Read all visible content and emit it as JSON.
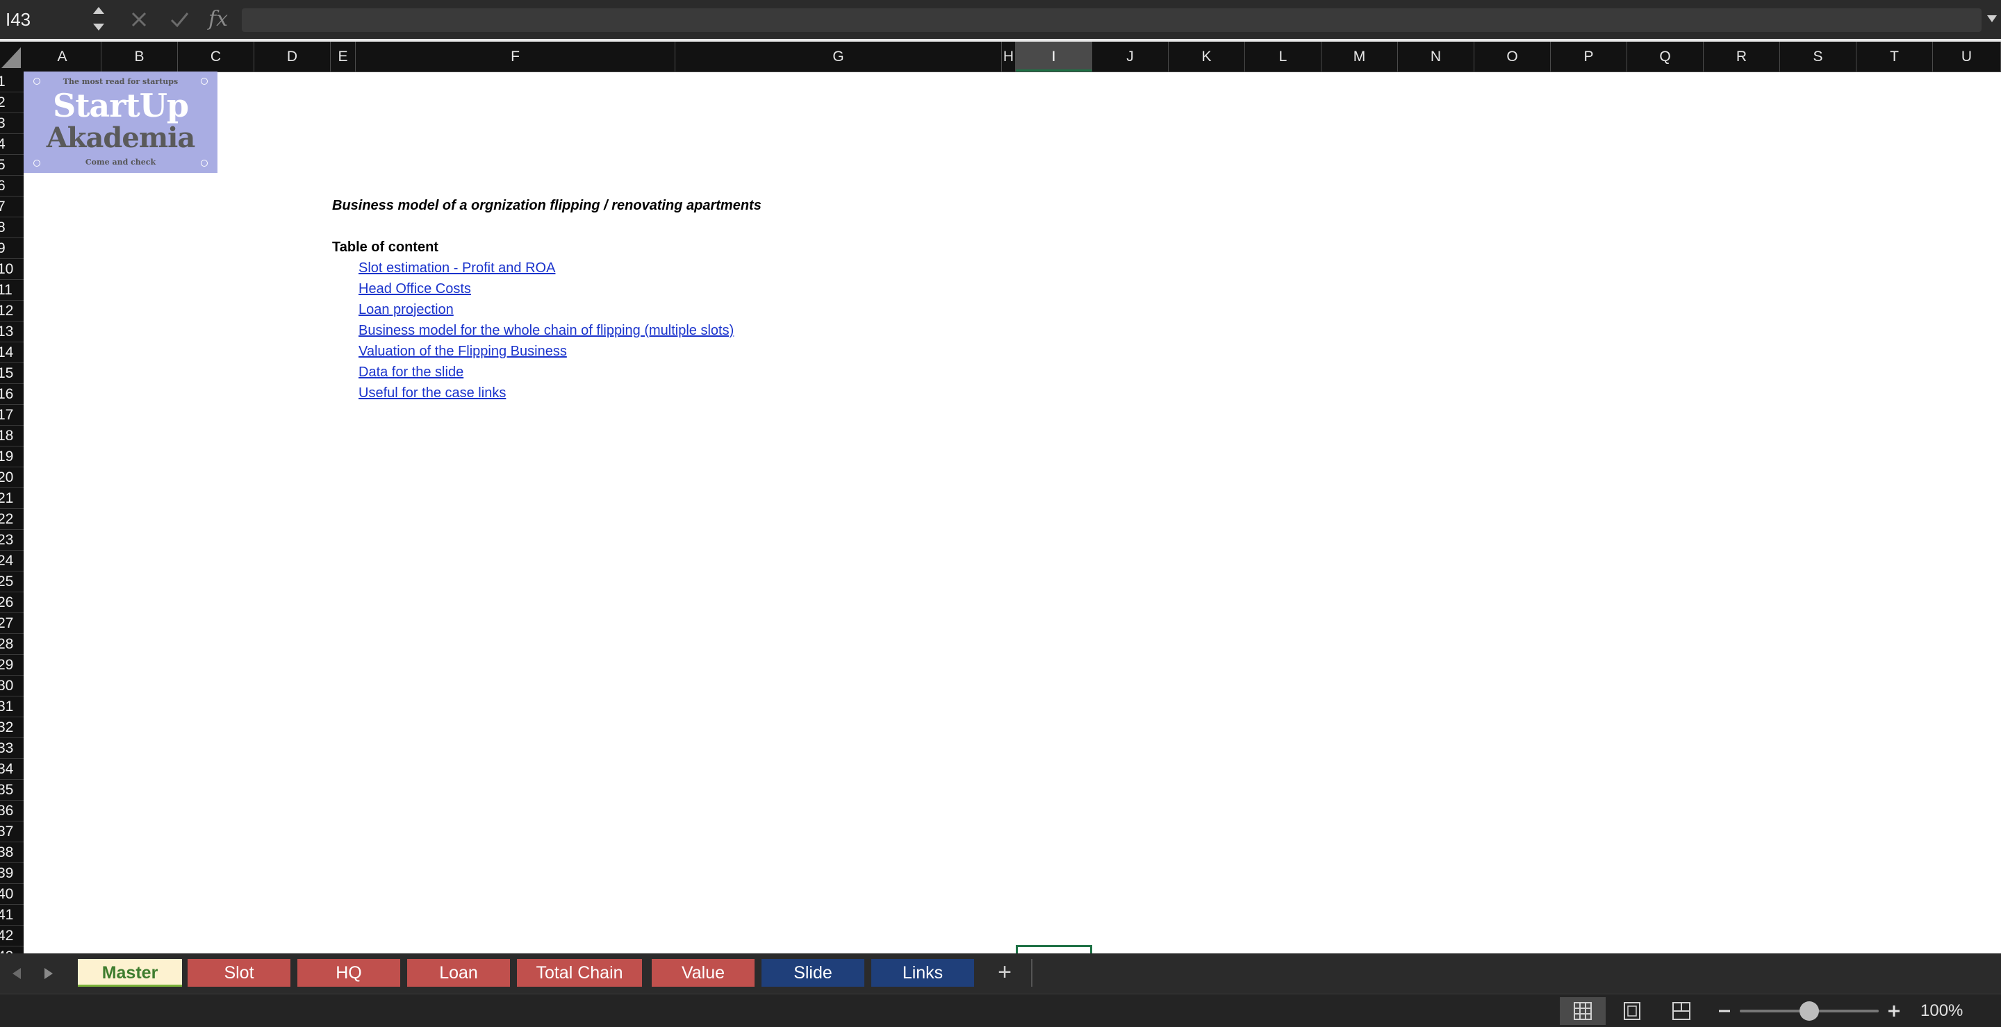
{
  "formula_bar": {
    "name_box": "I43",
    "fx_label": "fx",
    "formula_value": ""
  },
  "columns": [
    {
      "label": "A"
    },
    {
      "label": "B"
    },
    {
      "label": "C"
    },
    {
      "label": "D"
    },
    {
      "label": "E"
    },
    {
      "label": "F"
    },
    {
      "label": "G"
    },
    {
      "label": "H"
    },
    {
      "label": "I",
      "selected": true
    },
    {
      "label": "J"
    },
    {
      "label": "K"
    },
    {
      "label": "L"
    },
    {
      "label": "M"
    },
    {
      "label": "N"
    },
    {
      "label": "O"
    },
    {
      "label": "P"
    },
    {
      "label": "Q"
    },
    {
      "label": "R"
    },
    {
      "label": "S"
    },
    {
      "label": "T"
    },
    {
      "label": "U"
    }
  ],
  "rows": [
    "1",
    "2",
    "3",
    "4",
    "5",
    "6",
    "7",
    "8",
    "9",
    "10",
    "11",
    "12",
    "13",
    "14",
    "15",
    "16",
    "17",
    "18",
    "19",
    "20",
    "21",
    "22",
    "23",
    "24",
    "25",
    "26",
    "27",
    "28",
    "29",
    "30",
    "31",
    "32",
    "33",
    "34",
    "35",
    "36",
    "37",
    "38",
    "39",
    "40",
    "41",
    "42",
    "43"
  ],
  "logo": {
    "tagline": "The most read for startups",
    "line1": "StartUp",
    "line2": "Akademia",
    "footer": "Come and check"
  },
  "sheet": {
    "title": "Business model of a orgnization flipping / renovating apartments",
    "toc_heading": "Table of content",
    "toc_links": [
      "Slot estimation - Profit and ROA",
      "Head Office Costs",
      "Loan projection",
      "Business model for the whole chain of flipping (multiple slots)",
      "Valuation of the Flipping Business",
      "Data for the slide",
      "Useful for the case links"
    ]
  },
  "tabs": [
    {
      "label": "Master",
      "color": "#fdf2d0",
      "text_color": "#3f7d2f",
      "active": true
    },
    {
      "label": "Slot",
      "color": "#c0504d"
    },
    {
      "label": "HQ",
      "color": "#c0504d"
    },
    {
      "label": "Loan",
      "color": "#c0504d"
    },
    {
      "label": "Total Chain",
      "color": "#c0504d"
    },
    {
      "label": "Value",
      "color": "#c0504d"
    },
    {
      "label": "Slide",
      "color": "#1f3f7a"
    },
    {
      "label": "Links",
      "color": "#1f3f7a"
    }
  ],
  "add_sheet": "+",
  "status": {
    "zoom": "100%",
    "zoom_fraction": 0.5,
    "view_modes": [
      "normal-view-icon",
      "page-layout-icon",
      "page-break-preview-icon"
    ]
  },
  "colors": {
    "selection": "#1e7145",
    "link": "#1a33cc"
  }
}
